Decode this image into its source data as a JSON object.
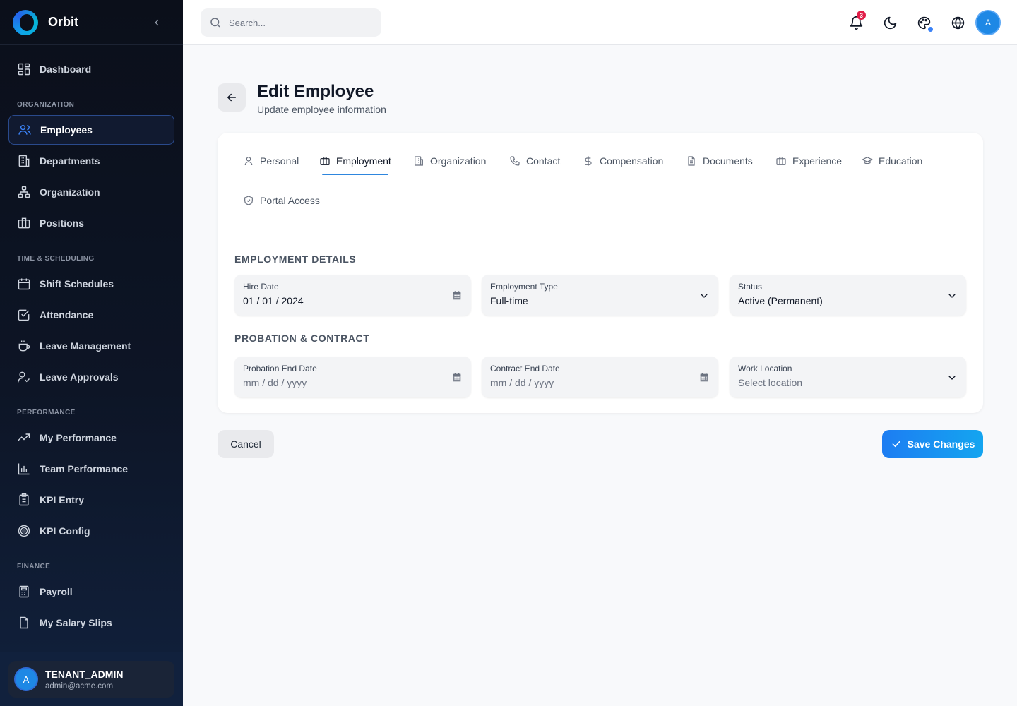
{
  "app": {
    "name": "Orbit"
  },
  "sidebar": {
    "top_items": [
      {
        "label": "Dashboard",
        "icon": "dashboard-icon"
      }
    ],
    "sections": [
      {
        "label": "ORGANIZATION",
        "items": [
          {
            "label": "Employees",
            "icon": "users-icon",
            "active": true
          },
          {
            "label": "Departments",
            "icon": "building-icon"
          },
          {
            "label": "Organization",
            "icon": "org-chart-icon"
          },
          {
            "label": "Positions",
            "icon": "briefcase-icon"
          }
        ]
      },
      {
        "label": "TIME & SCHEDULING",
        "items": [
          {
            "label": "Shift Schedules",
            "icon": "calendar-icon"
          },
          {
            "label": "Attendance",
            "icon": "checkbox-icon"
          },
          {
            "label": "Leave Management",
            "icon": "coffee-icon"
          },
          {
            "label": "Leave Approvals",
            "icon": "user-check-icon"
          }
        ]
      },
      {
        "label": "PERFORMANCE",
        "items": [
          {
            "label": "My Performance",
            "icon": "trend-icon"
          },
          {
            "label": "Team Performance",
            "icon": "bar-chart-icon"
          },
          {
            "label": "KPI Entry",
            "icon": "clipboard-icon"
          },
          {
            "label": "KPI Config",
            "icon": "target-icon"
          }
        ]
      },
      {
        "label": "FINANCE",
        "items": [
          {
            "label": "Payroll",
            "icon": "calculator-icon"
          },
          {
            "label": "My Salary Slips",
            "icon": "file-icon"
          }
        ]
      }
    ],
    "user": {
      "initial": "A",
      "role": "TENANT_ADMIN",
      "email": "admin@acme.com"
    }
  },
  "header": {
    "search_placeholder": "Search...",
    "notifications_count": "3",
    "avatar_initial": "A"
  },
  "page": {
    "title": "Edit Employee",
    "subtitle": "Update employee information"
  },
  "tabs": [
    {
      "label": "Personal",
      "icon": "user-icon"
    },
    {
      "label": "Employment",
      "icon": "briefcase-icon",
      "active": true
    },
    {
      "label": "Organization",
      "icon": "building-icon"
    },
    {
      "label": "Contact",
      "icon": "phone-icon"
    },
    {
      "label": "Compensation",
      "icon": "dollar-icon"
    },
    {
      "label": "Documents",
      "icon": "document-icon"
    },
    {
      "label": "Experience",
      "icon": "briefcase-icon"
    },
    {
      "label": "Education",
      "icon": "graduation-cap-icon"
    },
    {
      "label": "Portal Access",
      "icon": "shield-check-icon"
    }
  ],
  "form": {
    "employment_section": "EMPLOYMENT DETAILS",
    "probation_section": "PROBATION & CONTRACT",
    "hire_date": {
      "label": "Hire Date",
      "value": "01 / 01 / 2024"
    },
    "employment_type": {
      "label": "Employment Type",
      "value": "Full-time"
    },
    "status": {
      "label": "Status",
      "value": "Active (Permanent)"
    },
    "probation_end": {
      "label": "Probation End Date",
      "value": "mm / dd / yyyy"
    },
    "contract_end": {
      "label": "Contract End Date",
      "value": "mm / dd / yyyy"
    },
    "work_location": {
      "label": "Work Location",
      "value": "Select location"
    }
  },
  "actions": {
    "cancel": "Cancel",
    "save": "Save Changes"
  },
  "colors": {
    "accent": "#2e86de",
    "save_gradient_start": "#1d7df2",
    "save_gradient_end": "#14a5f0",
    "badge": "#e11d48",
    "sidebar_bg": "#0d1526"
  }
}
